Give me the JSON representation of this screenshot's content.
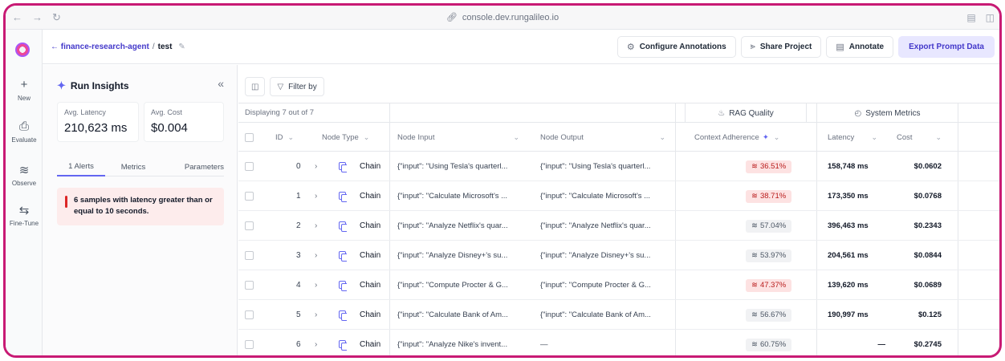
{
  "browser": {
    "url": "console.dev.rungalileo.io"
  },
  "rail": {
    "items": [
      {
        "label": "New",
        "icon": "plus-icon"
      },
      {
        "label": "Evaluate",
        "icon": "clipboard-icon"
      },
      {
        "label": "Observe",
        "icon": "pulse-icon"
      },
      {
        "label": "Fine-Tune",
        "icon": "loop-icon"
      }
    ]
  },
  "header": {
    "project": "← finance-research-agent",
    "separator": "/",
    "run": "test",
    "buttons": {
      "configure": "Configure Annotations",
      "share": "Share Project",
      "annotate": "Annotate",
      "export": "Export Prompt Data"
    }
  },
  "insights": {
    "title": "Run Insights",
    "stats": [
      {
        "label": "Avg. Latency",
        "value": "210,623 ms"
      },
      {
        "label": "Avg. Cost",
        "value": "$0.004"
      }
    ],
    "tabs": [
      "1 Alerts",
      "Metrics",
      "Parameters"
    ],
    "alert": "6 samples with latency greater than or equal to 10 seconds."
  },
  "table": {
    "filter_label": "Filter by",
    "displaying": "Displaying 7 out of 7",
    "groups": {
      "rag": "RAG Quality",
      "system": "System Metrics"
    },
    "headers": {
      "id": "ID",
      "node_type": "Node Type",
      "node_input": "Node Input",
      "node_output": "Node Output",
      "context_adherence": "Context Adherence",
      "latency": "Latency",
      "cost": "Cost"
    },
    "rows": [
      {
        "id": "0",
        "type": "Chain",
        "input": "{\"input\": \"Using Tesla's quarterl...",
        "output": "{\"input\": \"Using Tesla's quarterl...",
        "adherence": "36.51%",
        "status": "bad",
        "latency": "158,748 ms",
        "cost": "$0.0602"
      },
      {
        "id": "1",
        "type": "Chain",
        "input": "{\"input\": \"Calculate Microsoft's ...",
        "output": "{\"input\": \"Calculate Microsoft's ...",
        "adherence": "38.71%",
        "status": "bad",
        "latency": "173,350 ms",
        "cost": "$0.0768"
      },
      {
        "id": "2",
        "type": "Chain",
        "input": "{\"input\": \"Analyze Netflix's quar...",
        "output": "{\"input\": \"Analyze Netflix's quar...",
        "adherence": "57.04%",
        "status": "ok",
        "latency": "396,463 ms",
        "cost": "$0.2343"
      },
      {
        "id": "3",
        "type": "Chain",
        "input": "{\"input\": \"Analyze Disney+'s su...",
        "output": "{\"input\": \"Analyze Disney+'s su...",
        "adherence": "53.97%",
        "status": "ok",
        "latency": "204,561 ms",
        "cost": "$0.0844"
      },
      {
        "id": "4",
        "type": "Chain",
        "input": "{\"input\": \"Compute Procter & G...",
        "output": "{\"input\": \"Compute Procter & G...",
        "adherence": "47.37%",
        "status": "bad",
        "latency": "139,620 ms",
        "cost": "$0.0689"
      },
      {
        "id": "5",
        "type": "Chain",
        "input": "{\"input\": \"Calculate Bank of Am...",
        "output": "{\"input\": \"Calculate Bank of Am...",
        "adherence": "56.67%",
        "status": "ok",
        "latency": "190,997 ms",
        "cost": "$0.125"
      },
      {
        "id": "6",
        "type": "Chain",
        "input": "{\"input\": \"Analyze Nike's invent...",
        "output": "—",
        "adherence": "60.75%",
        "status": "ok",
        "latency": "—",
        "cost": "$0.2745"
      }
    ]
  }
}
